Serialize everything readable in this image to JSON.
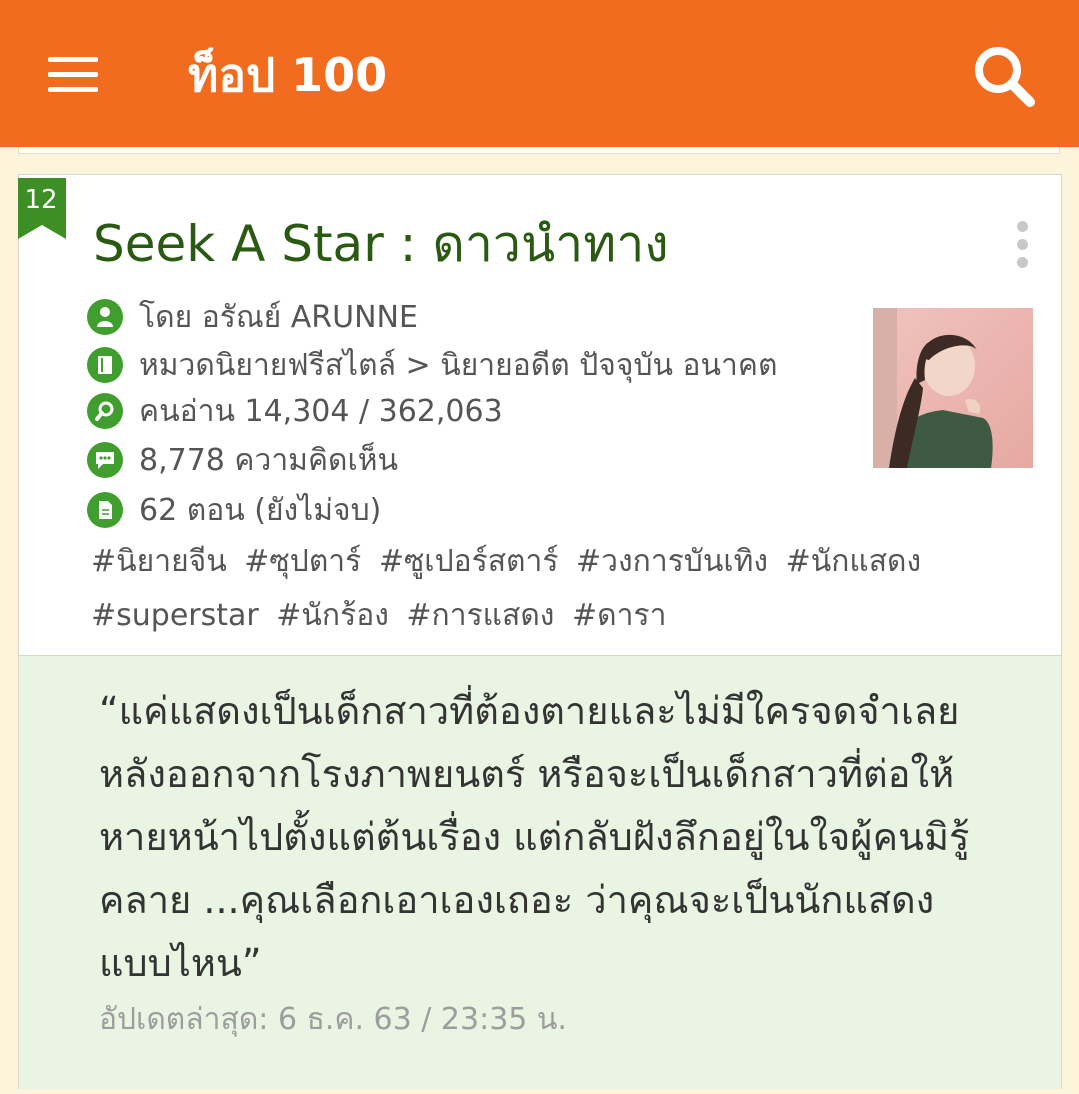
{
  "header": {
    "title": "ท็อป 100",
    "menu_icon": "hamburger-menu-icon",
    "search_icon": "search-icon",
    "bg_color": "#f26c1f"
  },
  "story": {
    "rank": "12",
    "title": "Seek A Star : ดาวนำทาง",
    "author_line": "โดย อรัณย์ ARUNNE",
    "category_line": "หมวดนิยายฟรีสไตล์ > นิยายอดีต ปัจจุบัน อนาคต",
    "readers_line": "คนอ่าน 14,304 / 362,063",
    "comments_line": "8,778 ความคิดเห็น",
    "episodes_line": "62 ตอน (ยังไม่จบ)",
    "tags": [
      "#นิยายจีน",
      "#ซุปตาร์",
      "#ซูเปอร์สตาร์",
      "#วงการบันเทิง",
      "#นักแสดง",
      "#superstar",
      "#นักร้อง",
      "#การแสดง",
      "#ดารา"
    ],
    "blurb": "“แค่แสดงเป็นเด็กสาวที่ต้องตายและไม่มีใครจดจำเลยหลังออกจากโรงภาพยนตร์ หรือจะเป็นเด็กสาวที่ต่อให้หายหน้าไปตั้งแต่ต้นเรื่อง แต่กลับฝังลึกอยู่ในใจผู้คนมิรู้คลาย ...คุณเลือกเอาเองเถอะ ว่าคุณจะเป็นนักแสดงแบบไหน”",
    "updated": "อัปเดตล่าสุด: 6 ธ.ค. 63 / 23:35 น.",
    "accent_color": "#3f9e2d",
    "title_color": "#2a5a12"
  }
}
